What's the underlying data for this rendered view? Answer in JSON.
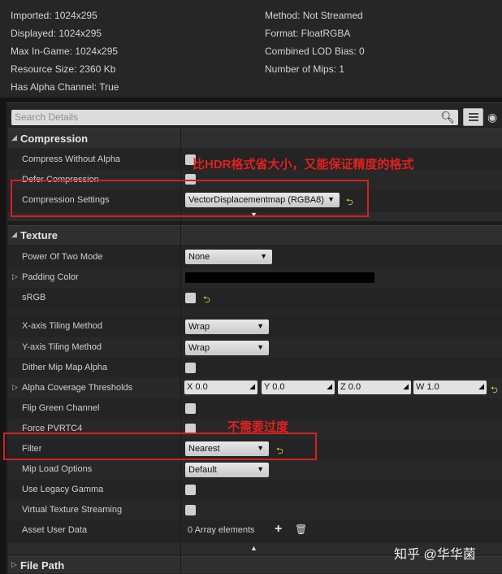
{
  "texture_info": {
    "imported": "Imported: 1024x295",
    "displayed": "Displayed: 1024x295",
    "max_in_game": "Max In-Game: 1024x295",
    "resource_size": "Resource Size: 2360 Kb",
    "has_alpha": "Has Alpha Channel: True",
    "method": "Method: Not Streamed",
    "format": "Format: FloatRGBA",
    "lod_bias": "Combined LOD Bias: 0",
    "num_mips": "Number of Mips: 1"
  },
  "search": {
    "placeholder": "Search Details"
  },
  "categories": {
    "compression": "Compression",
    "texture": "Texture",
    "file_path": "File Path"
  },
  "compression": {
    "compress_without_alpha": "Compress Without Alpha",
    "defer_compression": "Defer Compression",
    "compression_settings": "Compression Settings",
    "compression_settings_value": "VectorDisplacementmap (RGBA8)"
  },
  "texture": {
    "power_of_two_mode": "Power Of Two Mode",
    "power_of_two_value": "None",
    "padding_color": "Padding Color",
    "srgb": "sRGB",
    "x_tiling": "X-axis Tiling Method",
    "x_tiling_value": "Wrap",
    "y_tiling": "Y-axis Tiling Method",
    "y_tiling_value": "Wrap",
    "dither_mip_map_alpha": "Dither Mip Map Alpha",
    "alpha_coverage": "Alpha Coverage Thresholds",
    "alpha_x": "X 0.0",
    "alpha_y": "Y 0.0",
    "alpha_z": "Z 0.0",
    "alpha_w": "W 1.0",
    "flip_green": "Flip Green Channel",
    "force_pvrtc4": "Force PVRTC4",
    "filter": "Filter",
    "filter_value": "Nearest",
    "mip_load_options": "Mip Load Options",
    "mip_load_value": "Default",
    "use_legacy_gamma": "Use Legacy Gamma",
    "virtual_texture_streaming": "Virtual Texture Streaming",
    "asset_user_data": "Asset User Data",
    "asset_user_data_value": "0 Array elements"
  },
  "annotations": {
    "compression_note": "比HDR格式省大小，又能保证精度的格式",
    "filter_note": "不需要过度"
  },
  "watermark": "知乎 @华华菌",
  "colors": {
    "annotation_red": "#d42020",
    "reset_arrow": "#e0d040",
    "panel_bg": "#242424"
  }
}
